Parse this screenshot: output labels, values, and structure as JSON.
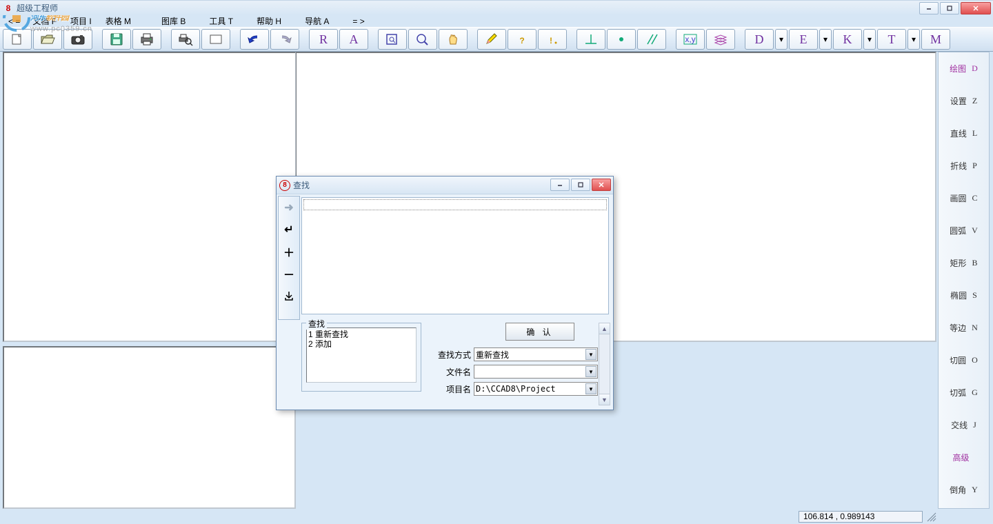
{
  "window": {
    "title": "超级工程师",
    "icon_glyph": "8"
  },
  "menu": {
    "items": [
      "文档 F",
      "项目 I",
      "表格 M",
      "图库 B",
      "工具 T",
      "帮助 H",
      "导航 A",
      "= >"
    ],
    "back": "< ="
  },
  "toolbar_letters": [
    "R",
    "A"
  ],
  "toolbar_dropdown_letters": [
    "D",
    "E",
    "K",
    "T",
    "M"
  ],
  "sidebar": [
    {
      "ch": "绘图",
      "key": "D",
      "accent": true
    },
    {
      "ch": "设置",
      "key": "Z"
    },
    {
      "ch": "直线",
      "key": "L"
    },
    {
      "ch": "折线",
      "key": "P"
    },
    {
      "ch": "画圆",
      "key": "C"
    },
    {
      "ch": "圆弧",
      "key": "V"
    },
    {
      "ch": "矩形",
      "key": "B"
    },
    {
      "ch": "椭圆",
      "key": "S"
    },
    {
      "ch": "等边",
      "key": "N"
    },
    {
      "ch": "切圆",
      "key": "O"
    },
    {
      "ch": "切弧",
      "key": "G"
    },
    {
      "ch": "交线",
      "key": "J"
    },
    {
      "ch": "高级",
      "key": "",
      "accent": true
    },
    {
      "ch": "倒角",
      "key": "Y"
    }
  ],
  "status": {
    "coords": "106.814  , 0.989143"
  },
  "dialog": {
    "title": "查找",
    "fieldset_label": "查找",
    "list_items": [
      "1 重新查找",
      "2 添加"
    ],
    "ok_label": "确 认",
    "rows": {
      "method_label": "查找方式",
      "method_value": "重新查找",
      "file_label": "文件名",
      "file_value": "",
      "proj_label": "项目名",
      "proj_value": "D:\\CCAD8\\Project"
    }
  },
  "watermark": {
    "brand_pre": "河东",
    "brand_post": "软件园",
    "url": "www.pc0359.cn"
  }
}
